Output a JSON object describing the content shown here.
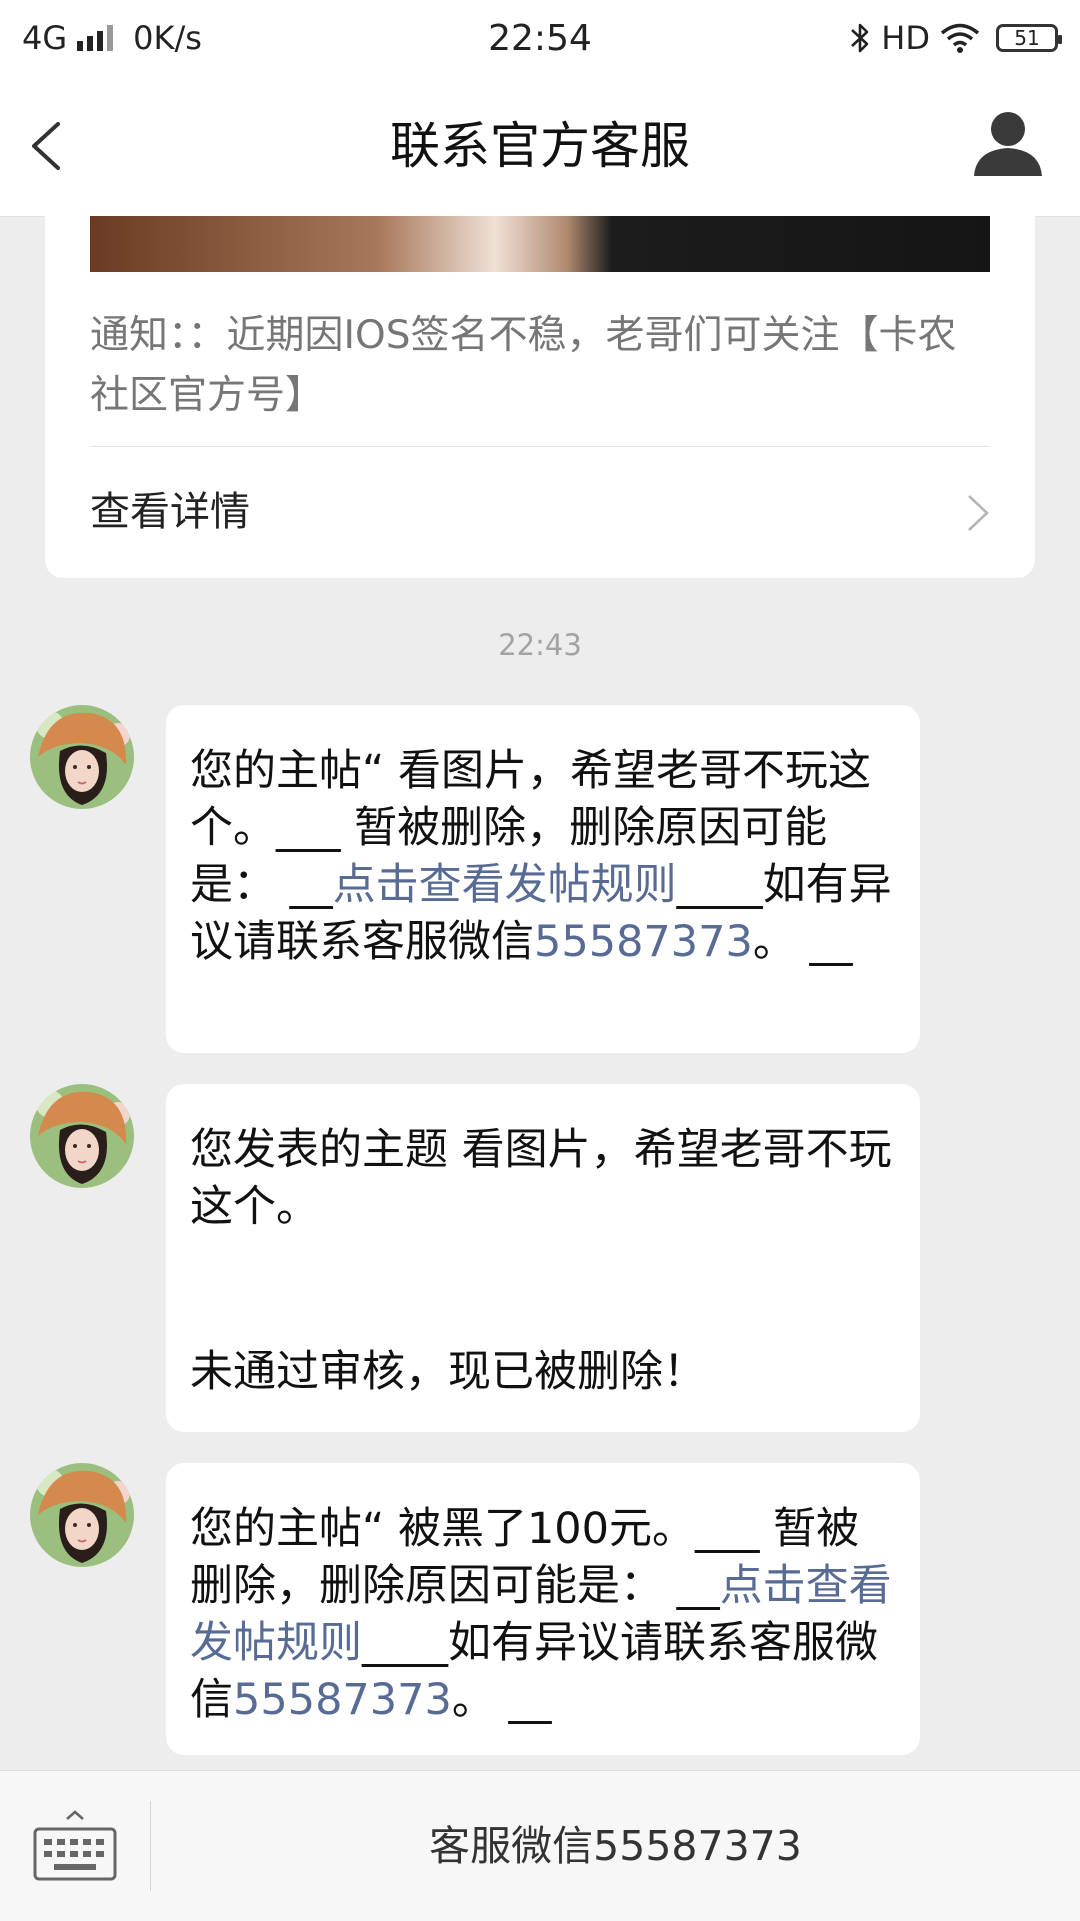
{
  "status_bar": {
    "network": "4G",
    "speed": "0K/s",
    "time": "22:54",
    "hd": "HD",
    "battery": "51"
  },
  "nav": {
    "title": "联系官方客服"
  },
  "notice_card": {
    "text": "通知：：近期因IOS签名不稳，老哥们可关注【卡农社区官方号】",
    "detail_label": "查看详情"
  },
  "timestamp": "22:43",
  "messages": [
    {
      "part1": "您的主帖“ 看图片，希望老哥不玩这个。___ 暂被删除，删除原因可能是：  __",
      "link": "点击查看发帖规则",
      "part2": "____如有异议请联系客服微信",
      "wechat": "55587373",
      "part3": "。 __"
    },
    {
      "line1": "您发表的主题 看图片，希望老哥不玩这个。",
      "line2": "未通过审核，现已被删除！"
    },
    {
      "part1": "您的主帖“ 被黑了100元。___ 暂被删除，删除原因可能是：  __",
      "link": "点击查看发帖规则",
      "part2": "____如有异议请联系客服微信",
      "wechat": "55587373",
      "part3": "。 __"
    }
  ],
  "bottom_bar": {
    "menu_label": "客服微信55587373"
  },
  "colors": {
    "link": "#576b95",
    "background": "#ededed"
  }
}
